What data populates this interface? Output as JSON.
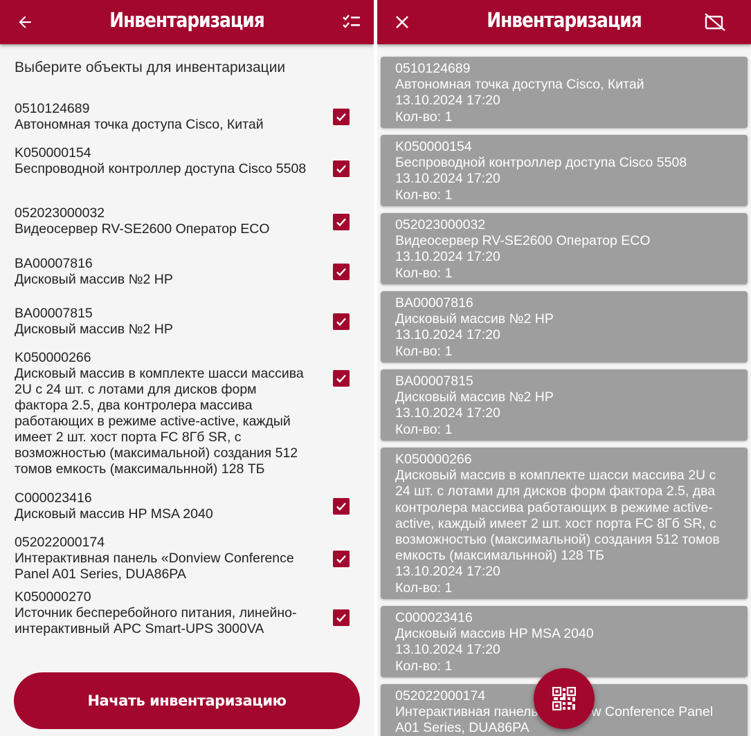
{
  "left": {
    "title": "Инвентаризация",
    "instruction": "Выберите объекты для инвентаризации",
    "start_button": "Начать инвентаризацию",
    "items": [
      {
        "code": "0510124689",
        "name": "Автономная точка доступа Cisco, Китай",
        "checked": true
      },
      {
        "code": "K050000154",
        "name": "Беспроводной контроллер доступа Cisco 5508",
        "checked": true
      },
      {
        "code": "052023000032",
        "name": "Видеосервер RV-SE2600 Оператор ECO",
        "checked": true
      },
      {
        "code": "BA00007816",
        "name": "Дисковый массив №2 HP",
        "checked": true
      },
      {
        "code": "BA00007815",
        "name": "Дисковый массив №2 HP",
        "checked": true
      },
      {
        "code": "K050000266",
        "name": "Дисковый массив в комплекте шасси массива 2U с 24 шт. с лотами для дисков форм фактора 2.5, два контролера массива работающих в режиме active-active, каждый имеет 2 шт. хост порта FC 8Гб SR, с возможностью (максимальной) создания 512 томов емкость (максимальнной) 128 ТБ",
        "checked": true
      },
      {
        "code": "C000023416",
        "name": "Дисковый массив HP MSA 2040",
        "checked": true
      },
      {
        "code": "052022000174",
        "name": "Интерактивная панель «Donview Conference Panel A01 Series, DUA86PA",
        "checked": true
      },
      {
        "code": "K050000270",
        "name": "Источник бесперебойного питания, линейно-интерактивный APC Smart-UPS 3000VA",
        "checked": true
      }
    ]
  },
  "right": {
    "title": "Инвентаризация",
    "qty_prefix": "Кол-во: ",
    "cards": [
      {
        "code": "0510124689",
        "name": "Автономная точка доступа Cisco, Китай",
        "datetime": "13.10.2024 17:20",
        "qty": "1"
      },
      {
        "code": "K050000154",
        "name": "Беспроводной контроллер доступа Cisco 5508",
        "datetime": "13.10.2024 17:20",
        "qty": "1"
      },
      {
        "code": "052023000032",
        "name": "Видеосервер RV-SE2600 Оператор ECO",
        "datetime": "13.10.2024 17:20",
        "qty": "1"
      },
      {
        "code": "BA00007816",
        "name": "Дисковый массив №2 HP",
        "datetime": "13.10.2024 17:20",
        "qty": "1"
      },
      {
        "code": "BA00007815",
        "name": "Дисковый массив №2 HP",
        "datetime": "13.10.2024 17:20",
        "qty": "1"
      },
      {
        "code": "K050000266",
        "name": "Дисковый массив в комплекте шасси массива 2U с 24 шт. с лотами для дисков форм фактора 2.5, два контролера массива работающих в режиме active-active, каждый имеет 2 шт. хост порта FC 8Гб SR, с возможностью (максимальной) создания 512 томов емкость (максимальнной) 128 ТБ",
        "datetime": "13.10.2024 17:20",
        "qty": "1"
      },
      {
        "code": "C000023416",
        "name": "Дисковый массив HP MSA 2040",
        "datetime": "13.10.2024 17:20",
        "qty": "1"
      },
      {
        "code": "052022000174",
        "name": "Интерактивная панель «Donview Conference Panel A01 Series, DUA86PA",
        "datetime": "",
        "qty": ""
      }
    ]
  },
  "colors": {
    "primary": "#a3072e",
    "card": "#9e9e9e",
    "background": "#f5f5f5"
  },
  "icons": {
    "back": "arrow-left-icon",
    "select_all": "checklist-icon",
    "close": "close-icon",
    "camera_off": "no-camera-icon",
    "scan": "qr-code-icon",
    "check": "checkmark-icon"
  }
}
